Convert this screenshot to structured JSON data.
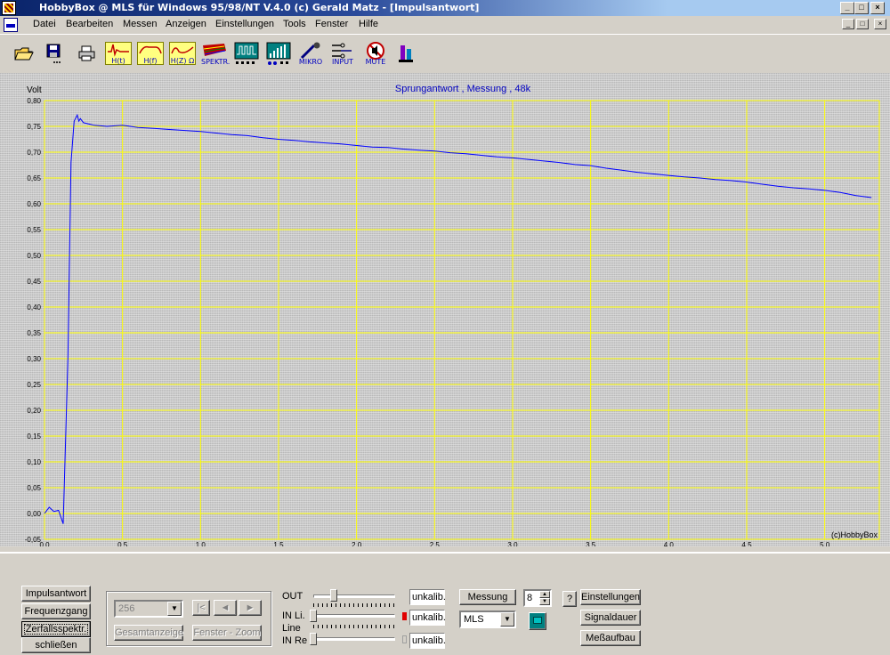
{
  "window": {
    "title": "HobbyBox @ MLS für Windows 95/98/NT  V.4.0   (c)  Gerald Matz - [Impulsantwort]",
    "controls": [
      "_",
      "□",
      "×"
    ]
  },
  "menu": {
    "items": [
      "Datei",
      "Bearbeiten",
      "Messen",
      "Anzeigen",
      "Einstellungen",
      "Tools",
      "Fenster",
      "Hilfe"
    ],
    "mdi_controls": [
      "_",
      "□",
      "×"
    ]
  },
  "toolbar": {
    "buttons": [
      {
        "name": "open",
        "icon": "folder-open-icon",
        "label": ""
      },
      {
        "name": "save",
        "icon": "floppy-disk-icon",
        "label": ""
      },
      {
        "name": "print",
        "icon": "printer-icon",
        "label": ""
      },
      {
        "name": "ht",
        "icon": "impulse-response-icon",
        "label": "H(t)"
      },
      {
        "name": "hf",
        "icon": "frequency-response-icon",
        "label": "H(f)"
      },
      {
        "name": "hz",
        "icon": "impedance-icon",
        "label": "H(Z) Ω"
      },
      {
        "name": "spektr",
        "icon": "spectrum-icon",
        "label": "SPEKTR."
      },
      {
        "name": "signal",
        "icon": "signal-generator-icon",
        "label": ""
      },
      {
        "name": "analyzer",
        "icon": "analyzer-icon",
        "label": ""
      },
      {
        "name": "mikro",
        "icon": "microphone-icon",
        "label": "MIKRO"
      },
      {
        "name": "input",
        "icon": "input-icon",
        "label": "INPUT"
      },
      {
        "name": "mute",
        "icon": "mute-icon",
        "label": "MUTE"
      },
      {
        "name": "tool",
        "icon": "tool-icon",
        "label": ""
      }
    ]
  },
  "colors": {
    "chart_bg": "#c8c8c8",
    "grid": "#ffff00",
    "trace": "#0000ff",
    "title": "#0000c0"
  },
  "chart_data": {
    "type": "line",
    "title": "Sprungantwort , Messung , 48k",
    "ylabel": "Volt",
    "xlabel": "",
    "watermark": "(c)HobbyBox",
    "xlim": [
      0.0,
      5.35
    ],
    "ylim": [
      -0.05,
      0.8
    ],
    "x_ticks": [
      "0,0",
      "0,5",
      "1,0",
      "1,5",
      "2,0",
      "2,5",
      "3,0",
      "3,5",
      "4,0",
      "4,5",
      "5,0"
    ],
    "y_ticks": [
      "0,80",
      "0,75",
      "0,70",
      "0,65",
      "0,60",
      "0,55",
      "0,50",
      "0,45",
      "0,40",
      "0,35",
      "0,30",
      "0,25",
      "0,20",
      "0,15",
      "0,10",
      "0,05",
      "0,00",
      "-0,05"
    ],
    "grid": true,
    "series": [
      {
        "x": [
          0.0,
          0.03,
          0.06,
          0.09,
          0.12,
          0.15,
          0.17,
          0.19,
          0.21,
          0.22,
          0.23,
          0.25,
          0.28,
          0.32,
          0.4,
          0.5,
          0.6,
          0.7,
          0.8,
          0.9,
          1.0,
          1.1,
          1.2,
          1.3,
          1.4,
          1.5,
          1.6,
          1.7,
          1.8,
          1.9,
          2.0,
          2.1,
          2.2,
          2.3,
          2.4,
          2.5,
          2.6,
          2.7,
          2.8,
          2.9,
          3.0,
          3.1,
          3.2,
          3.3,
          3.4,
          3.5,
          3.6,
          3.7,
          3.8,
          3.9,
          4.0,
          4.1,
          4.2,
          4.3,
          4.4,
          4.5,
          4.6,
          4.7,
          4.8,
          4.9,
          5.0,
          5.1,
          5.2,
          5.3
        ],
        "y": [
          0.0,
          0.012,
          0.004,
          0.006,
          -0.02,
          0.3,
          0.68,
          0.76,
          0.772,
          0.76,
          0.765,
          0.757,
          0.755,
          0.752,
          0.75,
          0.752,
          0.748,
          0.746,
          0.744,
          0.742,
          0.74,
          0.737,
          0.734,
          0.732,
          0.728,
          0.725,
          0.723,
          0.72,
          0.718,
          0.716,
          0.713,
          0.71,
          0.709,
          0.706,
          0.704,
          0.702,
          0.699,
          0.697,
          0.694,
          0.691,
          0.689,
          0.686,
          0.683,
          0.68,
          0.676,
          0.674,
          0.669,
          0.665,
          0.661,
          0.658,
          0.655,
          0.652,
          0.65,
          0.647,
          0.645,
          0.642,
          0.638,
          0.634,
          0.631,
          0.629,
          0.626,
          0.622,
          0.616,
          0.612
        ]
      }
    ]
  },
  "panel": {
    "nav_buttons": [
      "Impulsantwort",
      "Frequenzgang",
      "Zerfallsspektr.",
      "schließen"
    ],
    "window_size_value": "256",
    "nav_arrows": [
      "|<",
      "◄",
      "►"
    ],
    "gesamtanzeige": "Gesamtanzeige",
    "fenster_zoom": "Fenster - Zoom",
    "levels": [
      {
        "label": "OUT",
        "status": "unkalib."
      },
      {
        "label": "IN Li.",
        "status": "unkalib."
      },
      {
        "label": "Line",
        "status": ""
      },
      {
        "label": "IN Re",
        "status": "unkalib."
      }
    ],
    "messung_label": "Messung",
    "messung_count": "8",
    "signal_type": "MLS",
    "help": "?",
    "einstellungen": "Einstellungen",
    "signaldauer": "Signaldauer",
    "messaufbau": "Meßaufbau"
  }
}
